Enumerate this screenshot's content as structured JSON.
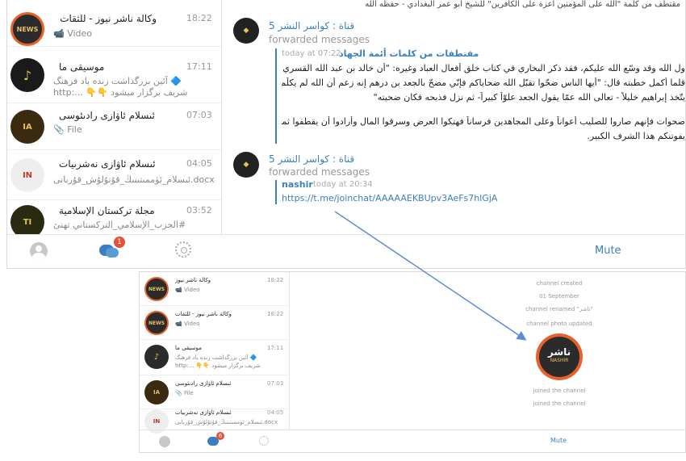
{
  "top": {
    "chats": [
      {
        "name": "وكالة ناشر نيوز - للثقات",
        "time": "18:22",
        "preview": "📹 Video",
        "avatar_text": "NEWS"
      },
      {
        "name": "موسيقى ما",
        "time": "17:11",
        "preview_line1": "🔷 آئين بزرگداشت زنده ياد فرهنگ",
        "preview_line2": "شريف برگزار ميشود 👇👇 ...:http",
        "avatar_text": "♪"
      },
      {
        "name": "ئىسلام ئاۋازى رادىئوسى",
        "time": "07:03",
        "preview": "📎 File",
        "avatar_text": "IA"
      },
      {
        "name": "ئىسلام ئاۋازى نەشرىيات",
        "time": "04:05",
        "preview": "ئىسلام_ئۈممىتىنىڭ_قۇتۇلۇش_قۇربانى.docx",
        "avatar_text": "IN"
      },
      {
        "name": "مجلة تركستان الإسلامية",
        "time": "03:52",
        "preview": "#الحزب_الإسلامي_التركستاني تهنئ",
        "avatar_text": "TI"
      }
    ],
    "badge": "1",
    "mute_label": "Mute",
    "header_line": "مقتطف من كلمة \"الله على المؤمنين أعزة على الكافرين\" للشيخ أبو عمر البغدادي - حفظه الله",
    "messages": [
      {
        "channel": "قناة : كواسر النشر 5",
        "forwarded": "forwarded messages",
        "fwd_title": "مقتطفات من كلمات أئمة الجهاد",
        "fwd_time": "today at 07:22",
        "lines": [
          "ول الله وقد وسّع الله عليكم، فقد ذكر البخاري في كتاب خلق أفعال العباد وغيره: \"أن خالد بن عبد الله القسري ضحّى بشيخ المعطّلة",
          "قلما أكمل خطبته قال: \"أيها الناس ضحّوا تقبّل الله ضحاياكم فإنّي مضحّ بالجعد بن درهم إنه زعم أن الله لم يكلّم موسى تكليماً ولم",
          "يتّخذ إبراهيم خليلاً - تعالى الله عمّا يقول الجعد علوّاً كبيراً- ثم نزل فذبحه فكان ضحيته\"",
          "صحوات فإنهم صاروا للصليب أعواناً وعلى المجاهدين فرساناً فهتكوا العرض وسرقوا المال وأرادوا أن يقطفوا ثمرة دماء الشهداء، فلا",
          "يفوتنكم هذا الشرف الكبير."
        ]
      },
      {
        "channel": "قناة : كواسر النشر 5",
        "forwarded": "forwarded messages",
        "sender": "nashir",
        "sender_time": "today at 20:34",
        "link": "https://t.me/joinchat/AAAAAEKBUpv3AeFs7hlGjA"
      }
    ]
  },
  "bottom": {
    "chats": [
      {
        "name": "وكالة ناشر نيوز",
        "time": "18:22",
        "preview": "📹 Video"
      },
      {
        "name": "وكالة ناشر نيوز - للثقات",
        "time": "18:22",
        "preview": "📹 Video"
      },
      {
        "name": "موسيقى ما",
        "time": "17:11",
        "preview_line1": "🔷 آئين بزرگداشت زنده ياد فرهنگ",
        "preview_line2": "شريف برگزار ميشود 👇👇 ...:http"
      },
      {
        "name": "ئىسلام ئاۋازى رادىئوسى",
        "time": "07:03",
        "preview": "📎 File"
      },
      {
        "name": "ئىسلام ئاۋازى نەشرىيات",
        "time": "04:05",
        "preview": "ئىسلام_ئۈممىتىنىڭ_قۇتۇلۇش_قۇربانى.docx"
      }
    ],
    "badge": "6",
    "mute_label": "Mute",
    "service": {
      "created": "channel created",
      "date": "01 September",
      "renamed": "channel renamed \"ناشر\"",
      "photo": "channel photo updated",
      "joined1": "joined the channel",
      "joined2": "joined the channel"
    },
    "logo_text": "ناشر",
    "logo_sub": "NASHIR"
  },
  "colors": {
    "accent": "#3a7fc1",
    "badge": "#e8503a",
    "arrow": "#5b8ed6"
  }
}
